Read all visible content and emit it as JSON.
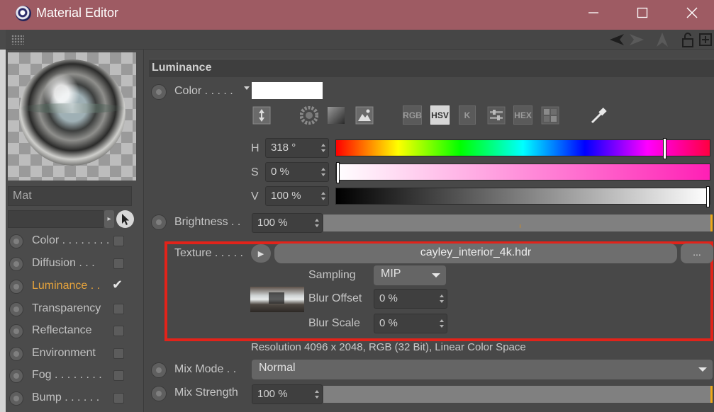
{
  "window": {
    "title": "Material Editor"
  },
  "material": {
    "name": "Mat"
  },
  "channels": [
    {
      "label": "Color . . . . . . . .",
      "checked": false,
      "active": false
    },
    {
      "label": "Diffusion . . .",
      "checked": false,
      "active": false
    },
    {
      "label": "Luminance . .",
      "checked": true,
      "active": true
    },
    {
      "label": "Transparency",
      "checked": false,
      "active": false
    },
    {
      "label": "Reflectance",
      "checked": false,
      "active": false
    },
    {
      "label": "Environment",
      "checked": false,
      "active": false
    },
    {
      "label": "Fog . . . . . . . .",
      "checked": false,
      "active": false
    },
    {
      "label": "Bump . . . . . .",
      "checked": false,
      "active": false
    }
  ],
  "section": {
    "title": "Luminance"
  },
  "color": {
    "label": "Color . . . . .",
    "swatch": "#ffffff",
    "modes": [
      "RGB",
      "HSV",
      "K",
      "HEX"
    ],
    "selected_mode": "HSV",
    "h_label": "H",
    "h_value": "318 °",
    "h_fraction": 0.883,
    "s_label": "S",
    "s_value": "0 %",
    "s_fraction": 0.0,
    "v_label": "V",
    "v_value": "100 %",
    "v_fraction": 1.0
  },
  "brightness": {
    "label": "Brightness . .",
    "value": "100 %",
    "fraction": 1.0
  },
  "texture": {
    "label": "Texture . . . . .",
    "file": "cayley_interior_4k.hdr",
    "more": "...",
    "sampling_label": "Sampling",
    "sampling_value": "MIP",
    "blur_offset_label": "Blur Offset",
    "blur_offset_value": "0 %",
    "blur_scale_label": "Blur Scale",
    "blur_scale_value": "0 %",
    "resolution": "Resolution 4096 x 2048, RGB (32 Bit), Linear Color Space"
  },
  "mix": {
    "mode_label": "Mix Mode . .",
    "mode_value": "Normal",
    "strength_label": "Mix Strength",
    "strength_value": "100 %",
    "strength_fraction": 1.0
  },
  "colors": {
    "titlebar": "#9e5b63",
    "active_channel": "#e6a33c",
    "highlight_box": "#e2231a"
  }
}
